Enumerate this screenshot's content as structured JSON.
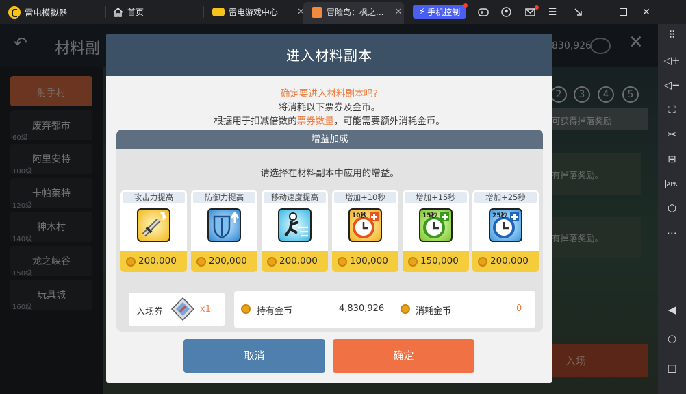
{
  "titlebar": {
    "app_name": "雷电模拟器",
    "tabs": [
      {
        "label": "首页"
      },
      {
        "label": "雷电游戏中心"
      },
      {
        "label": "冒险岛：枫之..."
      }
    ],
    "phone_control": "手机控制"
  },
  "game": {
    "header_title": "材料副",
    "gold_partial": "830,926",
    "active_city": "射手村",
    "cities": [
      {
        "name": "废弃都市",
        "level": "60级"
      },
      {
        "name": "阿里安特",
        "level": "100级"
      },
      {
        "name": "卡帕莱特",
        "level": "120级"
      },
      {
        "name": "神木村",
        "level": "140级"
      },
      {
        "name": "龙之峡谷",
        "level": "150级"
      },
      {
        "name": "玩具城",
        "level": "160级"
      }
    ],
    "stages": [
      "2",
      "3",
      "4",
      "5"
    ],
    "reward_header": "可获得掉落奖励",
    "reward_notes": [
      "有掉落奖励。",
      "有掉落奖励。"
    ],
    "enter_label": "入场"
  },
  "modal": {
    "title": "进入材料副本",
    "confirm_question": "确定要进入材料副本吗?",
    "consume_line": "将消耗以下票券及金币。",
    "note_before": "根据用于扣减倍数的",
    "note_highlight": "票券数量",
    "note_after": "，可能需要额外消耗金币。",
    "buff_header": "增益加成",
    "buff_prompt": "请选择在材料副本中应用的增益。",
    "buffs": [
      {
        "label": "攻击力提高",
        "price": "200,000",
        "icon": "sword-up-icon"
      },
      {
        "label": "防御力提高",
        "price": "200,000",
        "icon": "shield-up-icon"
      },
      {
        "label": "移动速度提高",
        "price": "200,000",
        "icon": "running-icon"
      },
      {
        "label": "增加+10秒",
        "price": "100,000",
        "icon": "clock-plus-icon",
        "tag": "10秒"
      },
      {
        "label": "增加+15秒",
        "price": "150,000",
        "icon": "clock-plus-icon",
        "tag": "15秒"
      },
      {
        "label": "增加+25秒",
        "price": "200,000",
        "icon": "clock-plus-icon",
        "tag": "25秒"
      }
    ],
    "ticket_label": "入场券",
    "ticket_count": "x1",
    "owned_gold_label": "持有金币",
    "owned_gold_value": "4,830,926",
    "consume_gold_label": "消耗金币",
    "consume_gold_value": "0",
    "cancel_label": "取消",
    "confirm_label": "确定"
  },
  "colors": {
    "highlight": "#ef7a3b",
    "cancel": "#4f80ad",
    "confirm": "#ef7144",
    "modal_title_bg": "#3d5166",
    "coin_bar": "#f5cc3c"
  }
}
